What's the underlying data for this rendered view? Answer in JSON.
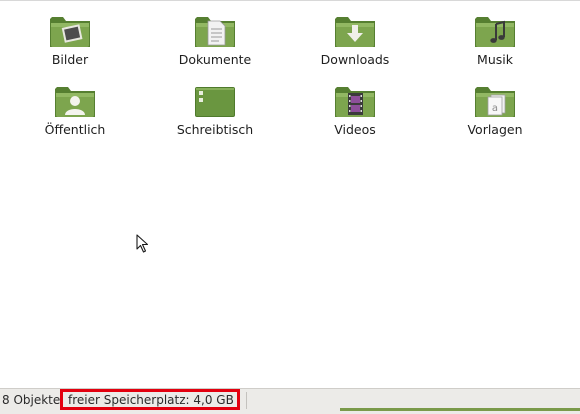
{
  "items": [
    {
      "label": "Bilder",
      "emblem": "picture-icon"
    },
    {
      "label": "Dokumente",
      "emblem": "document-icon"
    },
    {
      "label": "Downloads",
      "emblem": "download-arrow-icon"
    },
    {
      "label": "Musik",
      "emblem": "music-note-icon"
    },
    {
      "label": "Öffentlich",
      "emblem": "person-icon"
    },
    {
      "label": "Schreibtisch",
      "emblem": "desktop-icon"
    },
    {
      "label": "Videos",
      "emblem": "film-strip-icon"
    },
    {
      "label": "Vorlagen",
      "emblem": "template-icon"
    }
  ],
  "statusbar": {
    "count": "8 Objekte",
    "free_space": "freier Speicherplatz: 4,0 GB",
    "highlight_color": "#e3000f"
  },
  "colors": {
    "folder_green": "#6f9a43",
    "folder_dark": "#4f7a2c"
  }
}
